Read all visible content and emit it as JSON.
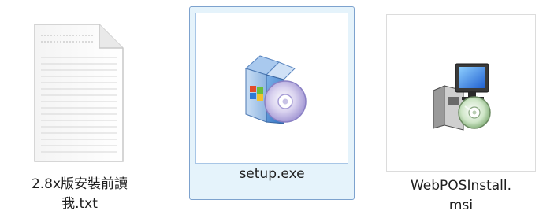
{
  "files": [
    {
      "name_line1": "2.8x版安裝前讀",
      "name_line2": "我.txt",
      "icon": "text-document-icon",
      "selected": false
    },
    {
      "name_line1": "setup.exe",
      "name_line2": "",
      "icon": "installer-box-cd-icon",
      "selected": true
    },
    {
      "name_line1": "WebPOSInstall.",
      "name_line2": "msi",
      "icon": "msi-installer-computer-icon",
      "selected": false
    }
  ],
  "colors": {
    "selection_fill": "#e5f3fb",
    "selection_border": "#7da2ce"
  }
}
